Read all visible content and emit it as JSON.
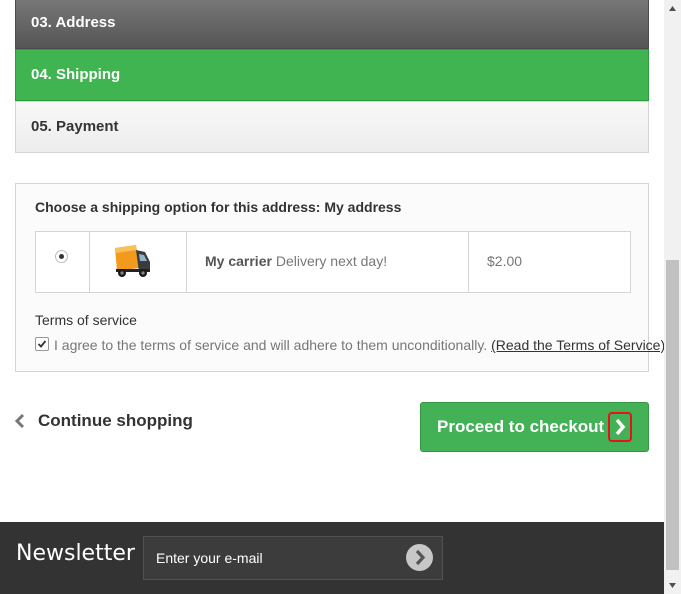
{
  "steps": {
    "address": "03. Address",
    "shipping": "04. Shipping",
    "payment": "05. Payment"
  },
  "shipping": {
    "title": "Choose a shipping option for this address: My address",
    "carrier_name": "My carrier",
    "carrier_delay": "Delivery next day!",
    "price": "$2.00",
    "selected": true
  },
  "terms": {
    "title": "Terms of service",
    "agree_text": "I agree to the terms of service and will adhere to them unconditionally.",
    "link_text": "(Read the Terms of Service)",
    "checked": true
  },
  "actions": {
    "continue_label": "Continue shopping",
    "checkout_label": "Proceed to checkout"
  },
  "newsletter": {
    "title": "Newsletter",
    "placeholder": "Enter your e-mail"
  },
  "colors": {
    "active_step": "#3fb450",
    "checkout_button": "#43b155",
    "footer": "#333333",
    "highlight": "#e4141b"
  }
}
